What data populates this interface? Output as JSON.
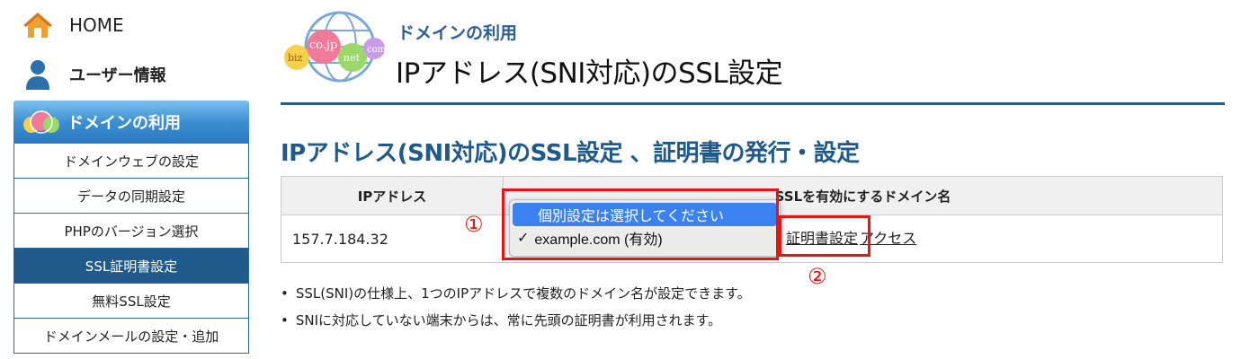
{
  "sidebar": {
    "home_label": "HOME",
    "user_label": "ユーザー情報",
    "section_label": "ドメインの利用",
    "items": [
      {
        "label": "ドメインウェブの設定",
        "active": false
      },
      {
        "label": "データの同期設定",
        "active": false
      },
      {
        "label": "PHPのバージョン選択",
        "active": false
      },
      {
        "label": "SSL証明書設定",
        "active": true
      },
      {
        "label": "無料SSL設定",
        "active": false
      },
      {
        "label": "ドメインメールの設定・追加",
        "active": false
      }
    ]
  },
  "header": {
    "logo_text": [
      "biz",
      "co.jp",
      "net",
      "com"
    ],
    "crumb": "ドメインの利用",
    "title": "IPアドレス(SNI対応)のSSL設定"
  },
  "section_title": "IPアドレス(SNI対応)のSSL設定 、証明書の発行・設定",
  "table": {
    "headers": [
      "IPアドレス",
      "SSLを有効にするドメイン名"
    ],
    "row": {
      "ip": "157.7.184.32",
      "dropdown": {
        "options": [
          {
            "label": "個別設定は選択してください",
            "highlighted": true
          },
          {
            "label": "example.com (有効)",
            "checked": true
          }
        ]
      },
      "links": [
        "証明書設定",
        "アクセス"
      ]
    }
  },
  "annotations": {
    "one": "①",
    "two": "②",
    "color": "#ee1111"
  },
  "notes": [
    "SSL(SNI)の仕様上、1つのIPアドレスで複数のドメイン名が設定できます。",
    "SNIに対応していない端末からは、常に先頭の証明書が利用されます。"
  ]
}
